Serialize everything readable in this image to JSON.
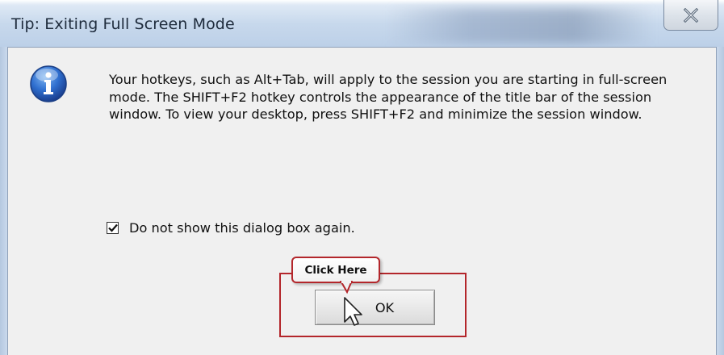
{
  "window": {
    "title": "Tip: Exiting Full Screen Mode",
    "close_icon": "close-icon"
  },
  "dialog": {
    "icon": "info-icon",
    "message": "Your hotkeys, such as Alt+Tab, will apply to the session you are starting in full-screen mode. The SHIFT+F2 hotkey controls the appearance of the title bar of the session window. To view your desktop, press SHIFT+F2 and minimize the session window.",
    "checkbox": {
      "label": "Do not show this dialog box again.",
      "checked": true
    },
    "ok_label": "OK"
  },
  "annotation": {
    "callout_text": "Click Here",
    "accent_color": "#b3262b"
  }
}
